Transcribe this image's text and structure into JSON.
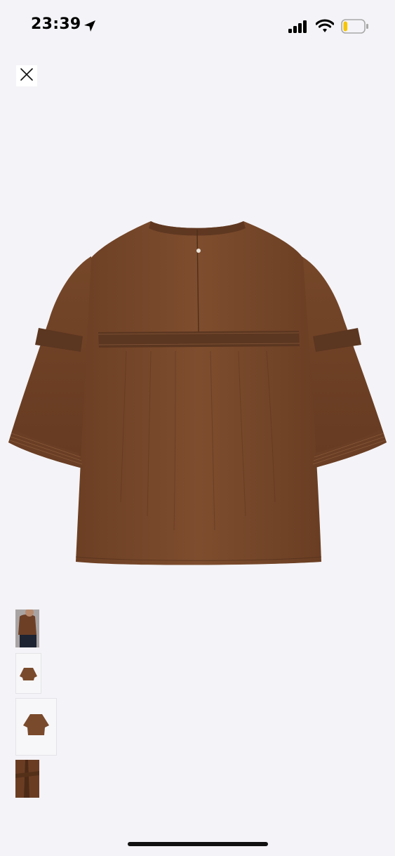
{
  "status_bar": {
    "time": "23:39",
    "icons": [
      "location-arrow-icon",
      "cellular-signal-icon",
      "wifi-icon",
      "battery-icon"
    ],
    "battery_fill_fraction": 0.2,
    "battery_color": "#f7c600"
  },
  "viewer": {
    "close_icon": "close-icon",
    "product_image": "brown-blouse-back-view",
    "product_color": "#7a4a2c",
    "thumbnails": [
      {
        "name": "thumbnail-model-front",
        "selected": false
      },
      {
        "name": "thumbnail-blouse-front",
        "selected": false
      },
      {
        "name": "thumbnail-blouse-back",
        "selected": true
      },
      {
        "name": "thumbnail-detail",
        "selected": false
      }
    ]
  }
}
